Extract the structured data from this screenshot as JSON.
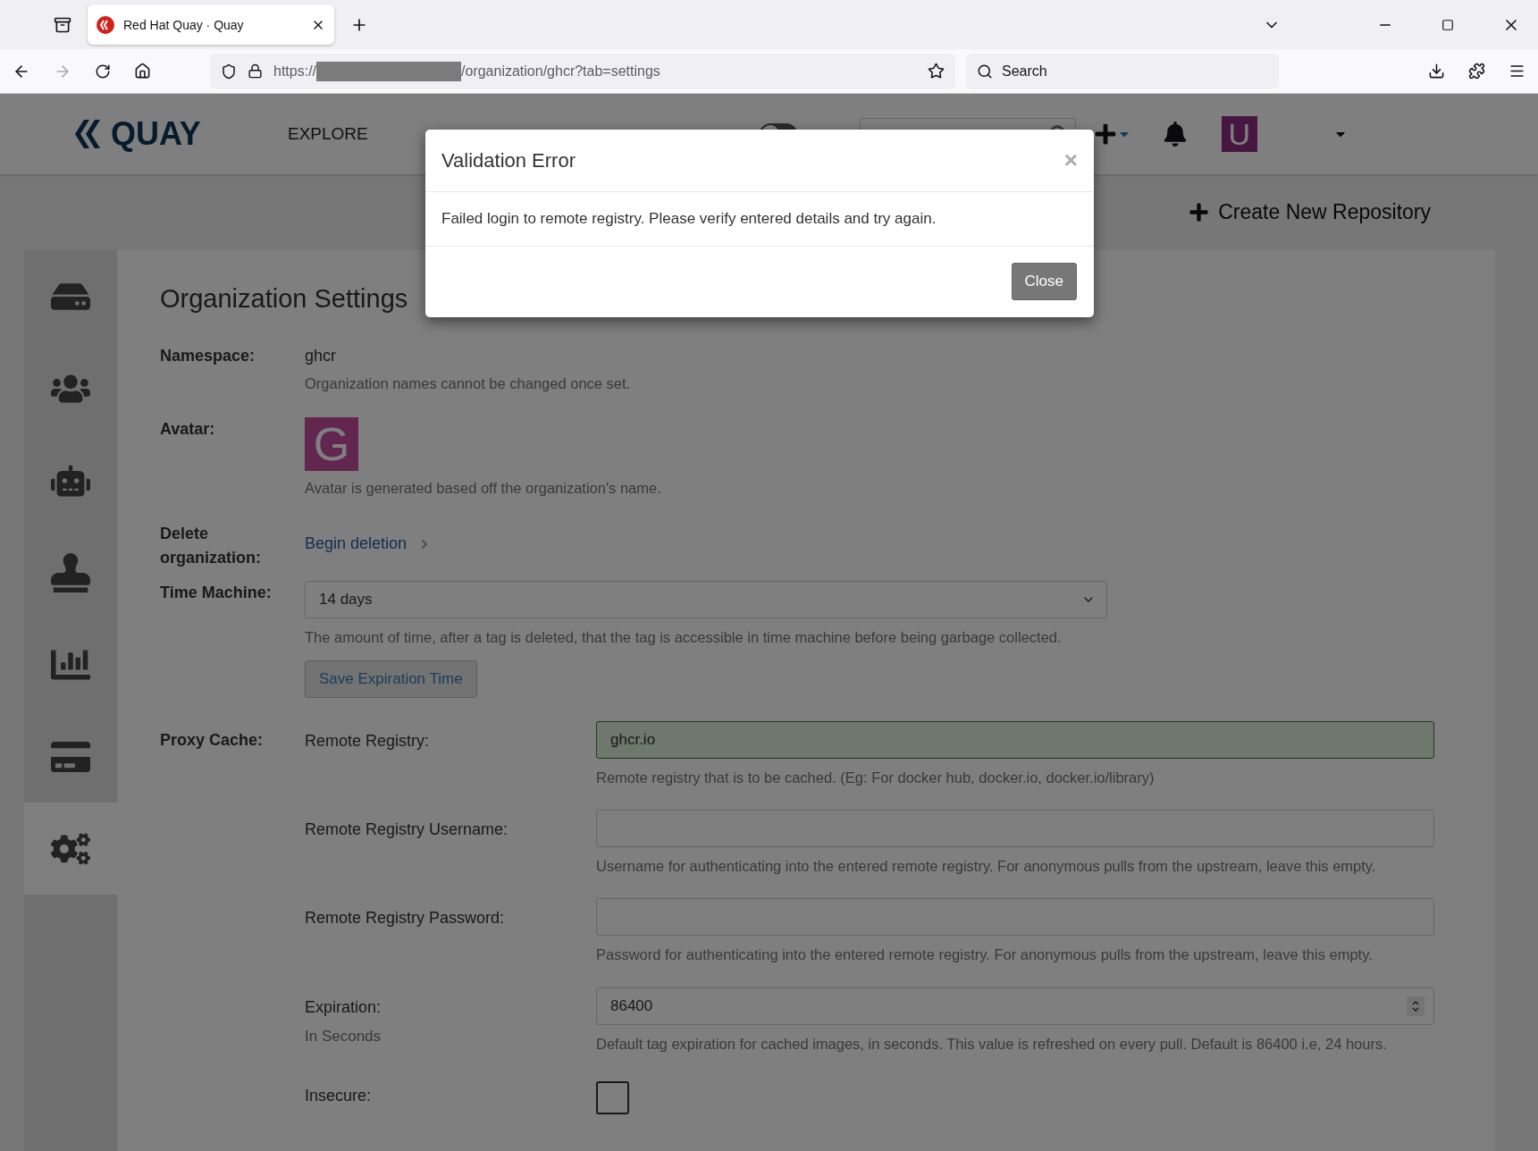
{
  "browser": {
    "tab_title": "Red Hat Quay · Quay",
    "url_prefix": "https://",
    "url_suffix": "/organization/ghcr?tab=settings",
    "search_placeholder": "Search"
  },
  "navbar": {
    "logo": "QUAY",
    "links": [
      "EXPLORE"
    ],
    "ui_toggle": {
      "on": false
    },
    "avatar": "U"
  },
  "create_repo": "Create New Repository",
  "sidebar": {
    "items": [
      {
        "selected": false
      },
      {
        "selected": false
      },
      {
        "selected": false
      },
      {
        "selected": false
      },
      {
        "selected": false
      },
      {
        "selected": false
      },
      {
        "selected": true
      }
    ]
  },
  "settings": {
    "title": "Organization Settings",
    "namespace": {
      "label": "Namespace:",
      "value": "ghcr",
      "help": "Organization names cannot be changed once set."
    },
    "avatar": {
      "label": "Avatar:",
      "letter": "G",
      "help": "Avatar is generated based off the organization's name."
    },
    "delete": {
      "label": "Delete organization:",
      "link": "Begin deletion"
    },
    "time_machine": {
      "label": "Time Machine:",
      "value": "14 days",
      "help": "The amount of time, after a tag is deleted, that the tag is accessible in time machine before being garbage collected.",
      "button": "Save Expiration Time"
    },
    "proxy_cache": {
      "label": "Proxy Cache:",
      "fields": [
        {
          "kind": "text",
          "label": "Remote Registry:",
          "value": "ghcr.io",
          "valid": true,
          "help": "Remote registry that is to be cached. (Eg: For docker hub, docker.io, docker.io/library)"
        },
        {
          "kind": "text",
          "label": "Remote Registry Username:",
          "valid": false,
          "help": "Username for authenticating into the entered remote registry. For anonymous pulls from the upstream, leave this empty."
        },
        {
          "kind": "text",
          "label": "Remote Registry Password:",
          "valid": false,
          "help": "Password for authenticating into the entered remote registry. For anonymous pulls from the upstream, leave this empty."
        },
        {
          "kind": "number",
          "label": "Expiration:",
          "sublabel": "In Seconds",
          "value": "86400",
          "valid": false,
          "help": "Default tag expiration for cached images, in seconds. This value is refreshed on every pull. Default is 86400 i.e, 24 hours."
        },
        {
          "kind": "checkbox",
          "label": "Insecure:",
          "checked": false
        }
      ]
    }
  },
  "modal": {
    "title": "Validation Error",
    "close_symbol": "×",
    "message": "Failed login to remote registry. Please verify entered details and try again.",
    "button": "Close"
  }
}
